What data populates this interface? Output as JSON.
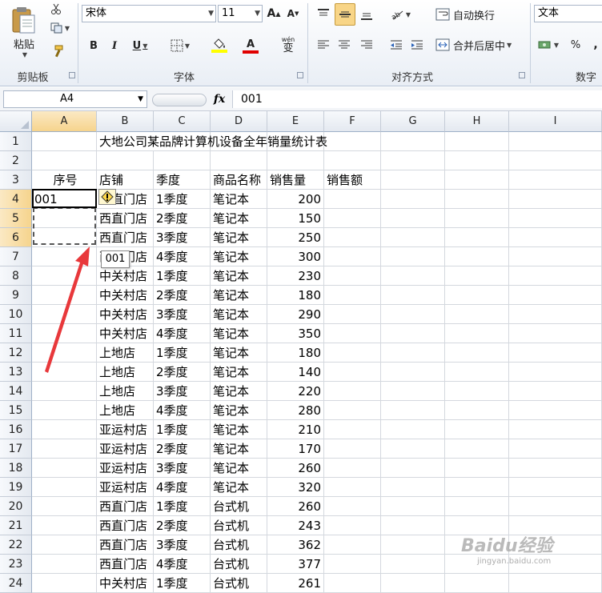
{
  "ribbon": {
    "clipboard": {
      "paste": "粘贴",
      "group": "剪贴板"
    },
    "font": {
      "name": "宋体",
      "size": "11",
      "group": "字体",
      "bold": "B",
      "italic": "I",
      "underline": "U",
      "grow": "A",
      "shrink": "A",
      "font_color_glyph": "A",
      "phonetic": "wén"
    },
    "align": {
      "wrap": "自动换行",
      "merge": "合并后居中",
      "group": "对齐方式"
    },
    "number": {
      "format": "文本",
      "group": "数字",
      "percent": "%",
      "comma": ","
    },
    "colors": {
      "fill_yellow": "#ffff00",
      "font_red": "#e00000",
      "selected_btn": "#f8d587"
    }
  },
  "formula_bar": {
    "name_box": "A4",
    "fx": "fx",
    "content": "001"
  },
  "columns": [
    "A",
    "B",
    "C",
    "D",
    "E",
    "F",
    "G",
    "H",
    "I"
  ],
  "rows": [
    "1",
    "2",
    "3",
    "4",
    "5",
    "6",
    "7",
    "8",
    "9",
    "10",
    "11",
    "12",
    "13",
    "14",
    "15",
    "16",
    "17",
    "18",
    "19",
    "20",
    "21",
    "22",
    "23",
    "24"
  ],
  "sheet": {
    "title": "大地公司某品牌计算机设备全年销量统计表",
    "headers": {
      "seq": "序号",
      "store": "店铺",
      "quarter": "季度",
      "product": "商品名称",
      "qty": "销售量",
      "amount": "销售额"
    },
    "a4": "001",
    "data": [
      [
        "西直门店",
        "1季度",
        "笔记本",
        "200"
      ],
      [
        "西直门店",
        "2季度",
        "笔记本",
        "150"
      ],
      [
        "西直门店",
        "3季度",
        "笔记本",
        "250"
      ],
      [
        "西直门店",
        "4季度",
        "笔记本",
        "300"
      ],
      [
        "中关村店",
        "1季度",
        "笔记本",
        "230"
      ],
      [
        "中关村店",
        "2季度",
        "笔记本",
        "180"
      ],
      [
        "中关村店",
        "3季度",
        "笔记本",
        "290"
      ],
      [
        "中关村店",
        "4季度",
        "笔记本",
        "350"
      ],
      [
        "上地店",
        "1季度",
        "笔记本",
        "180"
      ],
      [
        "上地店",
        "2季度",
        "笔记本",
        "140"
      ],
      [
        "上地店",
        "3季度",
        "笔记本",
        "220"
      ],
      [
        "上地店",
        "4季度",
        "笔记本",
        "280"
      ],
      [
        "亚运村店",
        "1季度",
        "笔记本",
        "210"
      ],
      [
        "亚运村店",
        "2季度",
        "笔记本",
        "170"
      ],
      [
        "亚运村店",
        "3季度",
        "笔记本",
        "260"
      ],
      [
        "亚运村店",
        "4季度",
        "笔记本",
        "320"
      ],
      [
        "西直门店",
        "1季度",
        "台式机",
        "260"
      ],
      [
        "西直门店",
        "2季度",
        "台式机",
        "243"
      ],
      [
        "西直门店",
        "3季度",
        "台式机",
        "362"
      ],
      [
        "西直门店",
        "4季度",
        "台式机",
        "377"
      ],
      [
        "中关村店",
        "1季度",
        "台式机",
        "261"
      ]
    ]
  },
  "autofill_tooltip": "001",
  "watermark": {
    "brand": "Baidu经验",
    "url": "jingyan.baidu.com"
  }
}
